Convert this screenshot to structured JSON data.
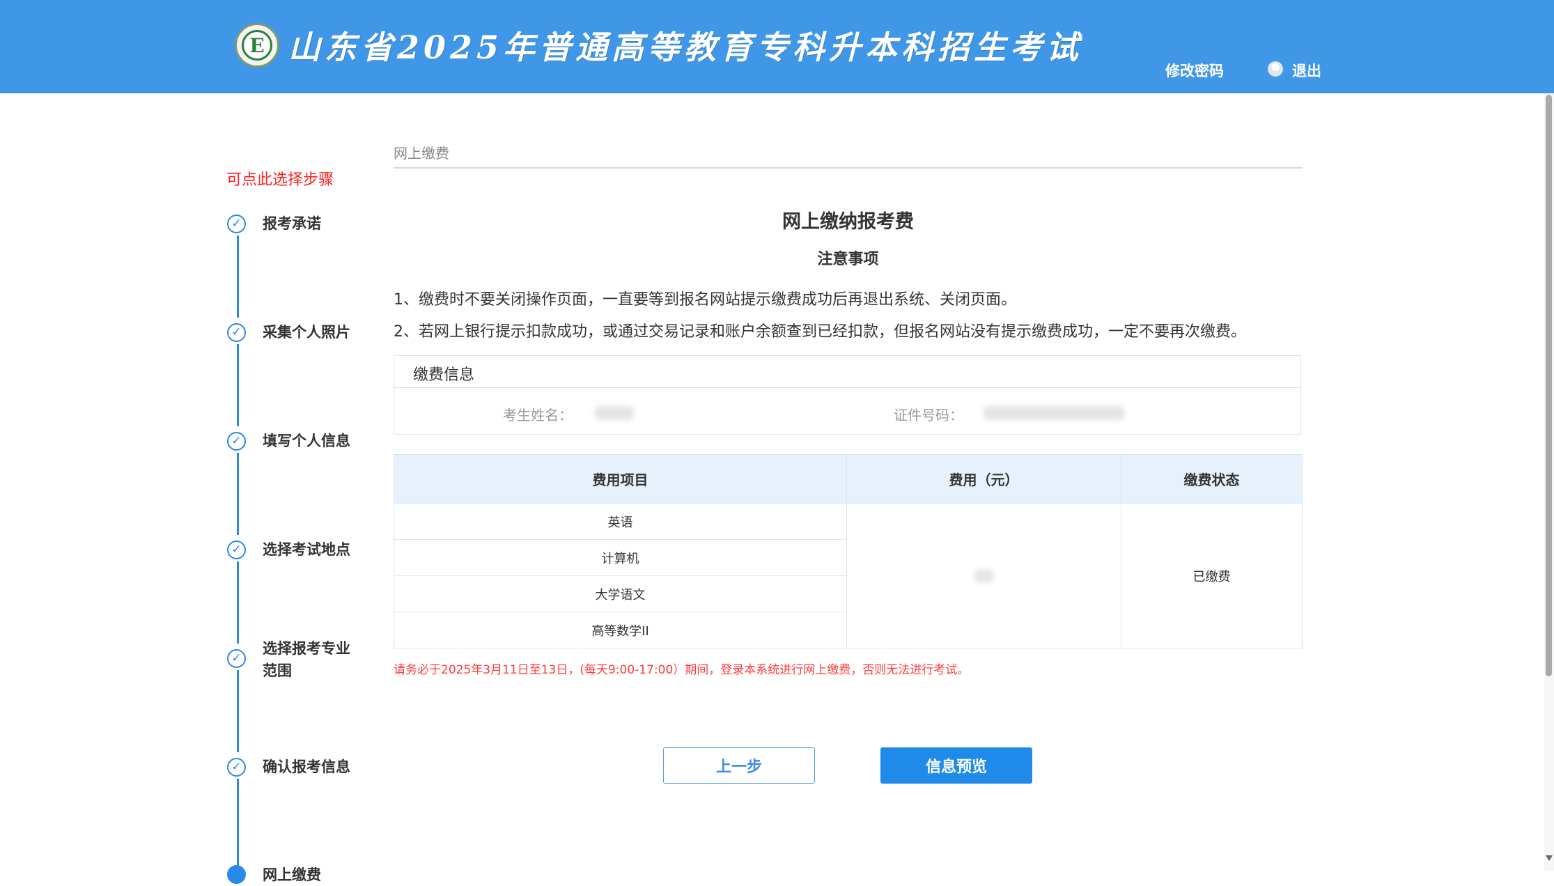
{
  "header": {
    "title": "山东省2025年普通高等教育专科升本科招生考试",
    "logo_letter": "E",
    "change_password": "修改密码",
    "logout": "退出"
  },
  "sidebar": {
    "hint": "可点此选择步骤",
    "steps": [
      {
        "label": "报考承诺",
        "completed": true
      },
      {
        "label": "采集个人照片",
        "completed": true
      },
      {
        "label": "填写个人信息",
        "completed": true
      },
      {
        "label": "选择考试地点",
        "completed": true
      },
      {
        "label": "选择报考专业范围",
        "completed": true
      },
      {
        "label": "确认报考信息",
        "completed": true
      },
      {
        "label": "网上缴费",
        "completed": false,
        "current": true
      }
    ]
  },
  "main": {
    "breadcrumb": "网上缴费",
    "title": "网上缴纳报考费",
    "notice_title": "注意事项",
    "notices": [
      "1、缴费时不要关闭操作页面，一直要等到报名网站提示缴费成功后再退出系统、关闭页面。",
      "2、若网上银行提示扣款成功，或通过交易记录和账户余额查到已经扣款，但报名网站没有提示缴费成功，一定不要再次缴费。"
    ],
    "payment_info": {
      "title": "缴费信息",
      "name_label": "考生姓名：",
      "id_label": "证件号码："
    },
    "table": {
      "headers": [
        "费用项目",
        "费用（元）",
        "缴费状态"
      ],
      "items": [
        "英语",
        "计算机",
        "大学语文",
        "高等数学II"
      ],
      "status": "已缴费"
    },
    "warning": "请务必于2025年3月11日至13日，(每天9:00-17:00）期间，登录本系统进行网上缴费，否则无法进行考试。",
    "buttons": {
      "prev": "上一步",
      "next": "信息预览"
    }
  },
  "colors": {
    "header": "#4097e8",
    "accent": "#2a88e6",
    "warning": "#ff3b3b",
    "table_header": "#e6f1fc"
  }
}
